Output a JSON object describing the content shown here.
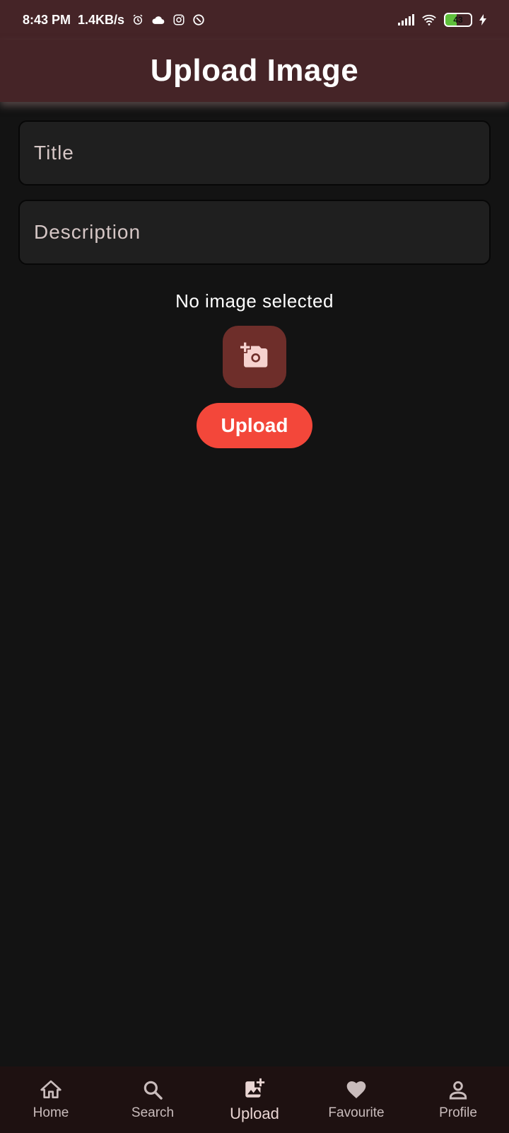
{
  "status_bar": {
    "time": "8:43 PM",
    "speed": "1.4KB/s",
    "battery": "43"
  },
  "app_bar": {
    "title": "Upload Image"
  },
  "form": {
    "title_placeholder": "Title",
    "description_placeholder": "Description"
  },
  "image_status": "No image selected",
  "buttons": {
    "add_photo_icon": "add-a-photo",
    "upload_label": "Upload"
  },
  "bottom_nav": {
    "items": [
      {
        "label": "Home",
        "icon": "home"
      },
      {
        "label": "Search",
        "icon": "search"
      },
      {
        "label": "Upload",
        "icon": "add-photo-alternate",
        "active": true
      },
      {
        "label": "Favourite",
        "icon": "heart"
      },
      {
        "label": "Profile",
        "icon": "person"
      }
    ]
  },
  "colors": {
    "app_bar": "#452427",
    "background": "#131313",
    "field": "#1f1f1f",
    "camera_button": "#6e2e2a",
    "upload_button": "#f3473a",
    "bottom_nav": "#1e1111"
  }
}
